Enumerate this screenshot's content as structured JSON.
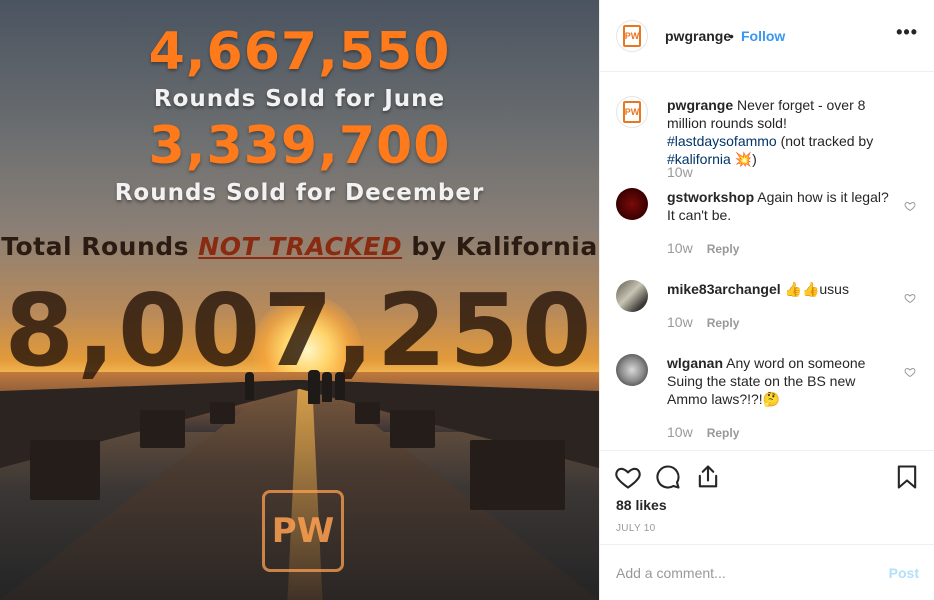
{
  "post_image": {
    "line1_number": "4,667,550",
    "line1_caption": "Rounds Sold for June",
    "line2_number": "3,339,700",
    "line2_caption": "Rounds Sold for December",
    "total_prefix": "Total Rounds ",
    "total_emphasis": "NOT TRACKED",
    "total_suffix": " by Kalifornia",
    "total_number": "8,007,250",
    "logo_text": "PW"
  },
  "header": {
    "username": "pwgrange",
    "separator": "•",
    "follow_label": "Follow",
    "more_label": "•••"
  },
  "caption": {
    "username": "pwgrange",
    "text_before": " Never forget - over 8 million rounds sold! ",
    "hashtag1": "#lastdaysofammo",
    "text_middle": " (not tracked by ",
    "hashtag2": "#kalifornia",
    "text_end": " 💥)",
    "time": "10w"
  },
  "comments": [
    {
      "username": "gstworkshop",
      "text": " Again how is it legal? It can't be.",
      "time": "10w",
      "reply_label": "Reply"
    },
    {
      "username": "mike83archangel",
      "text": " 👍👍usus",
      "time": "10w",
      "reply_label": "Reply"
    },
    {
      "username": "wlganan",
      "text": " Any word on someone Suing the state on the BS new Ammo laws?!?!🤔",
      "time": "10w",
      "reply_label": "Reply"
    }
  ],
  "actions": {
    "likes": "88 likes",
    "date": "JULY 10"
  },
  "add_comment": {
    "placeholder": "Add a comment...",
    "post_label": "Post"
  },
  "colors": {
    "accent_link": "#3897f0",
    "hashtag": "#003569",
    "orange_text": "#ff7a1a",
    "post_disabled": "#b2dffc"
  }
}
